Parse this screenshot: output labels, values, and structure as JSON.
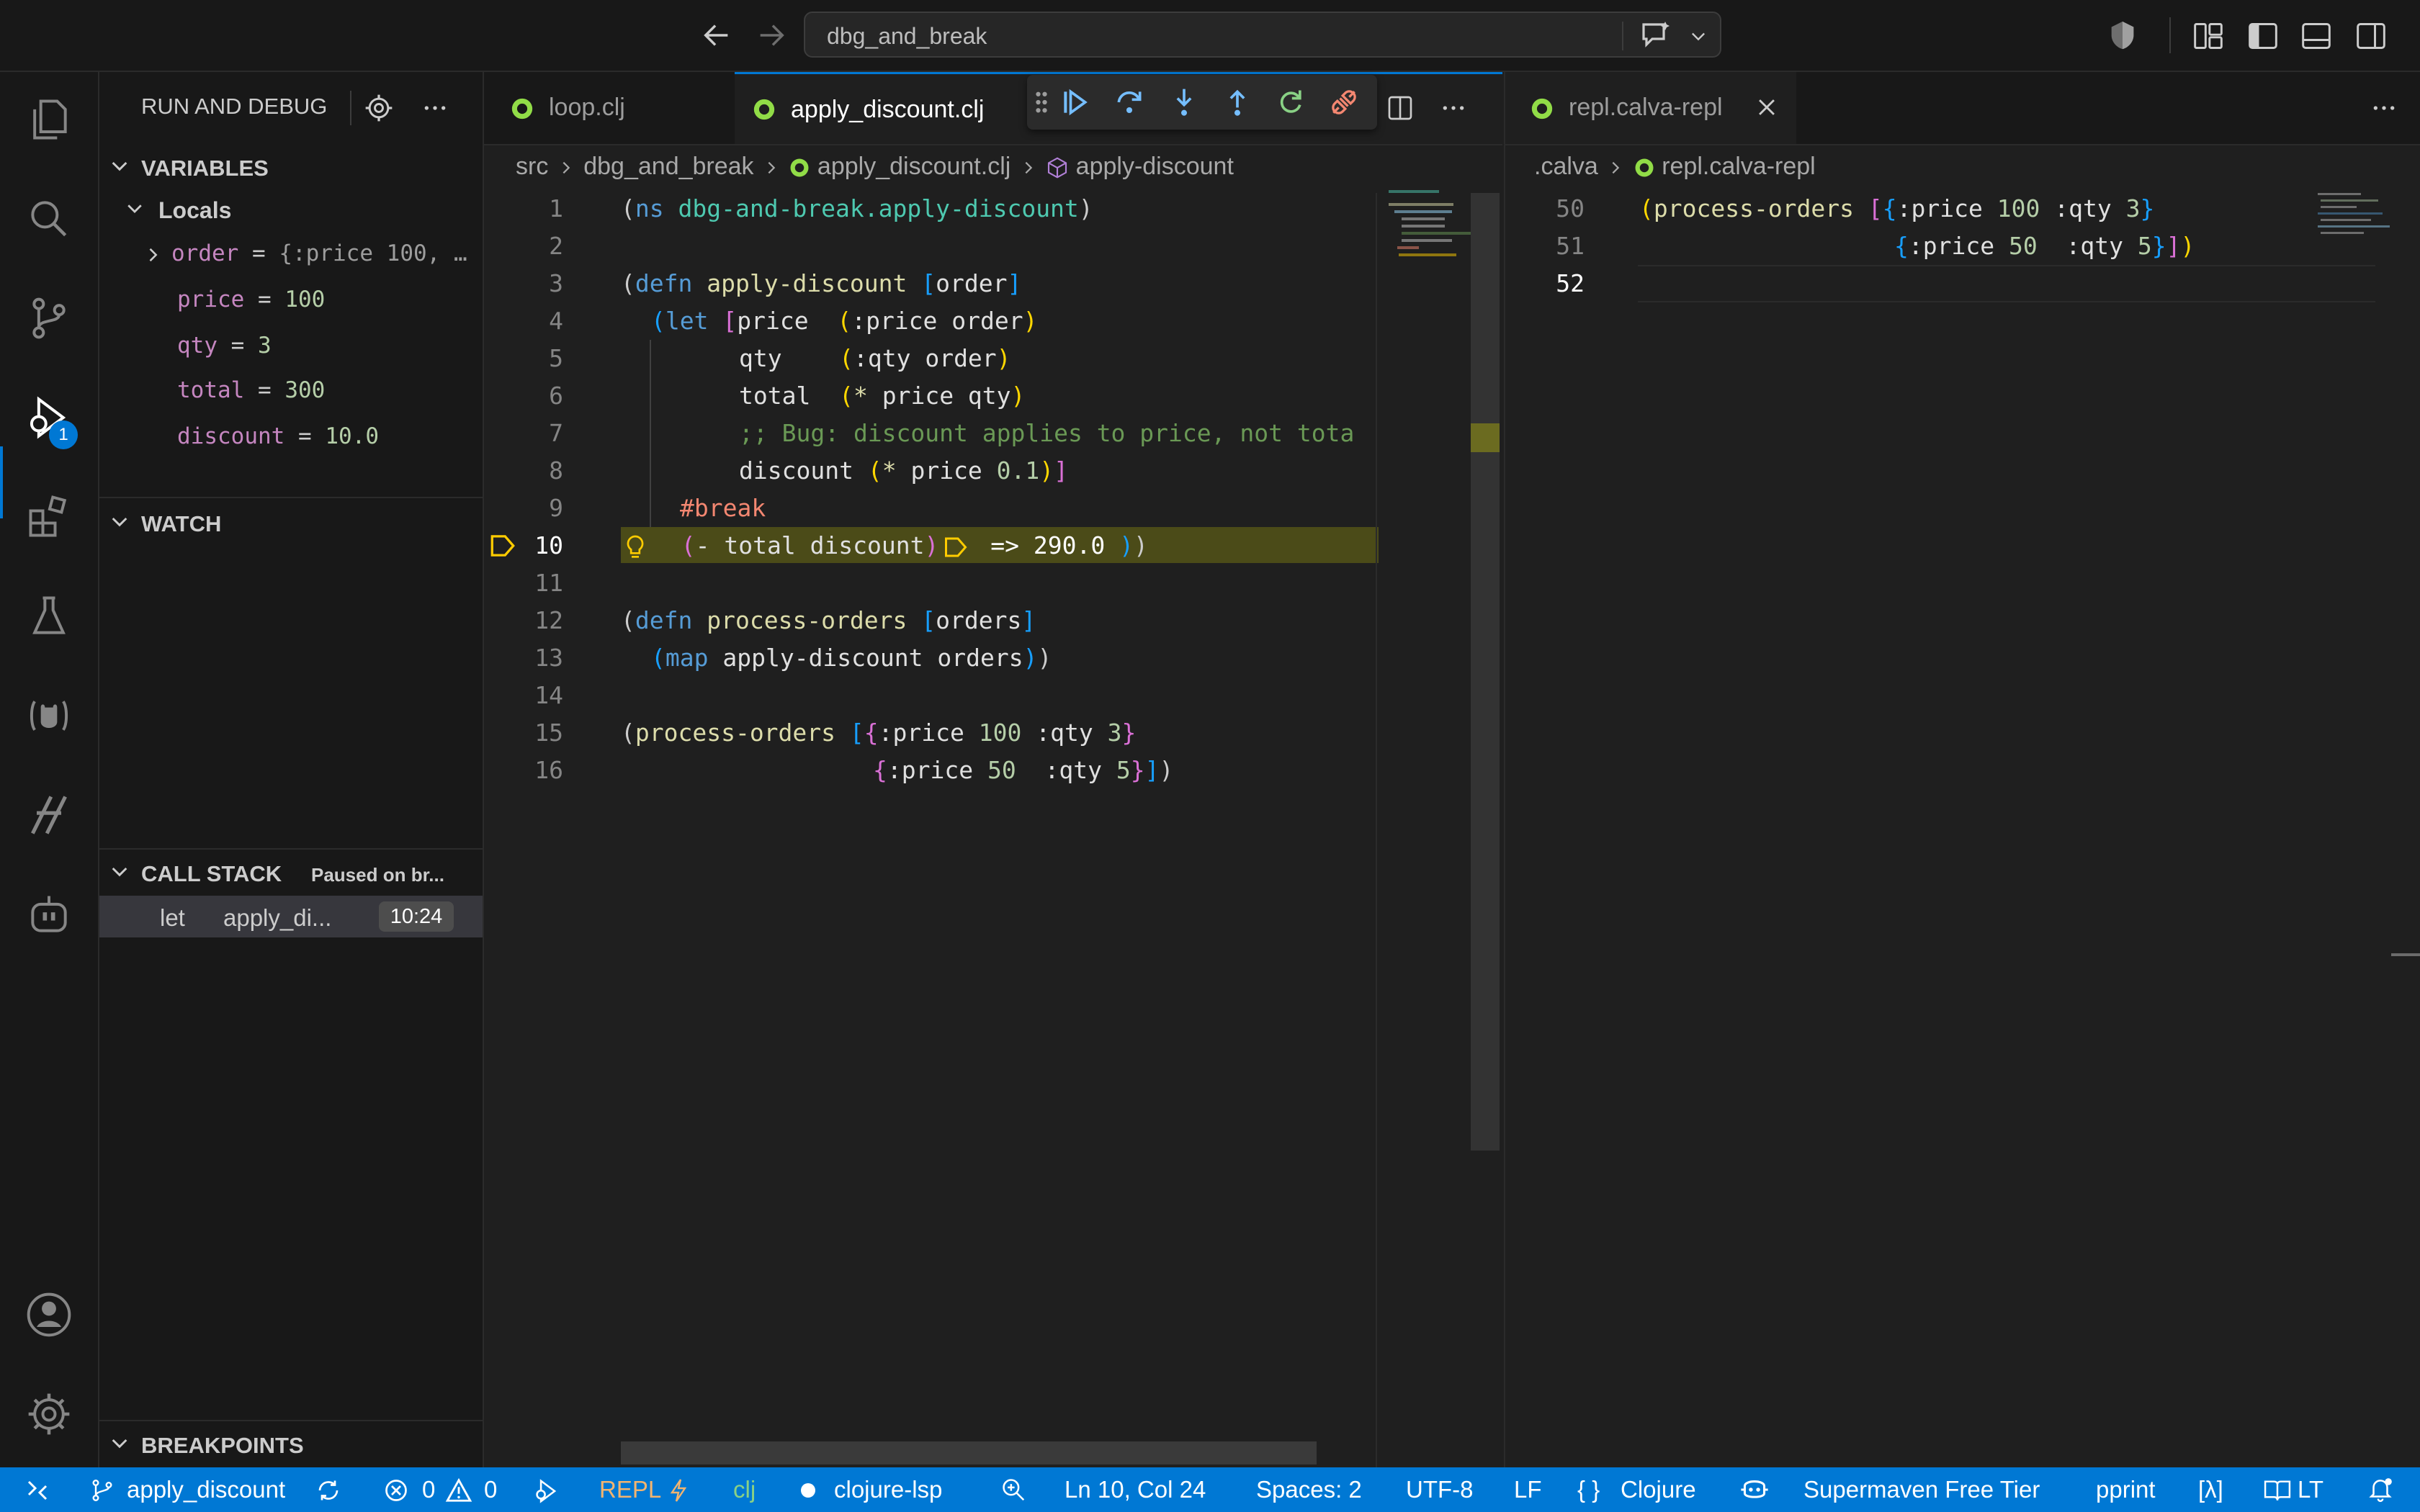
{
  "window": {
    "search_text": "dbg_and_break"
  },
  "activity_bar": {
    "debug_badge": "1"
  },
  "sidebar": {
    "title": "RUN AND DEBUG",
    "variables_label": "VARIABLES",
    "locals_label": "Locals",
    "variables": [
      {
        "name": "order",
        "value": "{:price 100, …"
      },
      {
        "name": "price",
        "value": "100"
      },
      {
        "name": "qty",
        "value": "3"
      },
      {
        "name": "total",
        "value": "300"
      },
      {
        "name": "discount",
        "value": "10.0"
      }
    ],
    "eq": "=",
    "watch_label": "WATCH",
    "call_stack_label": "CALL STACK",
    "call_stack_status": "Paused on br...",
    "call_stack_frame": {
      "kind": "let",
      "name": "apply_di...",
      "position": "10:24"
    },
    "breakpoints_label": "BREAKPOINTS"
  },
  "editor1": {
    "tabs": [
      {
        "label": "loop.clj"
      },
      {
        "label": "apply_discount.clj"
      }
    ],
    "breadcrumb": [
      "src",
      "dbg_and_break",
      "apply_discount.clj",
      "apply-discount"
    ],
    "line_numbers": [
      "1",
      "2",
      "3",
      "4",
      "5",
      "6",
      "7",
      "8",
      "9",
      "10",
      "11",
      "12",
      "13",
      "14",
      "15",
      "16"
    ],
    "code": {
      "l1_open": "(",
      "l1_ns": "ns",
      "l1_name": "dbg-and-break.apply-discount",
      "l1_close": ")",
      "l3_defn": "defn",
      "l3_fn": "apply-discount",
      "l3_arg": "order",
      "l4_let": "let",
      "l4_price": "price",
      "l4_kw": ":price",
      "l4_order": "order",
      "l5_qty": "qty",
      "l5_kw": ":qty",
      "l5_order": "order",
      "l6_total": "total",
      "l6_mul": "*",
      "l6_args": "price qty",
      "l7_comment": ";; Bug: discount applies to price, not tota",
      "l8_discount": "discount",
      "l8_mul": "*",
      "l8_price": "price",
      "l8_num": "0.1",
      "l9_tag": "#break",
      "l10_fn": "- total discount",
      "l10_result": "=> 290.0",
      "l12_defn": "defn",
      "l12_fn": "process-orders",
      "l12_arg": "orders",
      "l13_map": "map",
      "l13_args": "apply-discount orders",
      "l15_fn": "process-orders",
      "l15_k1": ":price",
      "l15_v1": "100",
      "l15_k2": ":qty",
      "l15_v2": "3",
      "l16_k1": ":price",
      "l16_v1": "50",
      "l16_k2": ":qty",
      "l16_v2": "5"
    }
  },
  "editor2": {
    "tab_label": "repl.calva-repl",
    "breadcrumb": [
      ".calva",
      "repl.calva-repl"
    ],
    "line_numbers": [
      "50",
      "51",
      "52"
    ],
    "code": {
      "fn": "process-orders",
      "k1": ":price",
      "v1": "100",
      "k2": ":qty",
      "v2": "3",
      "k3": ":price",
      "v3": "50",
      "k4": ":qty",
      "v4": "5"
    }
  },
  "status_bar": {
    "branch": "apply_discount",
    "errors": "0",
    "warnings": "0",
    "repl": "REPL",
    "lang_short": "clj",
    "lsp": "clojure-lsp",
    "position": "Ln 10, Col 24",
    "spaces": "Spaces: 2",
    "encoding": "UTF-8",
    "eol": "LF",
    "language": "Clojure",
    "supermaven": "Supermaven Free Tier",
    "pprint": "pprint",
    "lambda": "[λ]",
    "lt": "LT"
  },
  "colors": {
    "accent": "#0078d4",
    "active_line": "#4b4b18",
    "breakpoint": "#ffcc00"
  }
}
